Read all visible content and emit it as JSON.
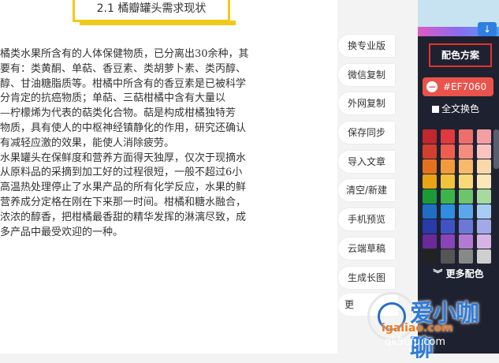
{
  "editor": {
    "heading": "2.1 橘瓣罐头需求现状",
    "lines": [
      "橘类水果所含有的人体保健物质，已分离出30余种，其",
      "要有：类黄酮、单萜、香豆素、类胡萝卜素、类丙醇、",
      "醇、甘油糖脂质等。柑橘中所含有的香豆素是已被科学",
      "分肯定的抗癌物质；单萜、三萜柑橘中含有大量以",
      "—柠檬烯为代表的萜类化合物。萜是构成柑橘独特芳",
      "物质，具有使人的中枢神经镇静化的作用，研究还确认",
      "有减轻应激的效果，能使人消除疲劳。",
      "水果罐头在保鲜度和营养方面得天独厚，仅次于现摘水",
      "从原料品的采摘到加工好的过程很短，一般不超过6小",
      "高温热处理停止了水果产品的所有化学反应，水果的鲜",
      "营养成分定格在刚在下来那一时间。柑橘和糖水融合，",
      "浓浓的醇香，把柑橘最香甜的精华发挥的淋漓尽致，成",
      "多产品中最受欢迎的一种。"
    ]
  },
  "toolbar": {
    "buttons": [
      "换专业版",
      "微信复制",
      "外网复制",
      "保存同步",
      "导入文章",
      "清空/新建",
      "手机预览",
      "云端草稿",
      "生成长图"
    ],
    "partial": "更"
  },
  "panel": {
    "banner_arrow": "↓",
    "title": "配色方案",
    "color_value": "#EF7060",
    "minus_icon": "−",
    "full_swap_label": "全文换色",
    "more_colors": "更多配色",
    "more_colors_icon": "︾",
    "swatches": [
      [
        "#c0282d",
        "#e0393e",
        "#ee6e6b",
        "#f39fa4"
      ],
      [
        "#d33f2f",
        "#ef5d4f",
        "#f58c7d",
        "#f7c4c2"
      ],
      [
        "#e5711f",
        "#f39a3a",
        "#f7b96a",
        "#f9d9a9"
      ],
      [
        "#e8a316",
        "#f3c23b",
        "#f7da77",
        "#fae8b8"
      ],
      [
        "#1c9a37",
        "#3cb44b",
        "#6ec46b",
        "#a8d9a0"
      ],
      [
        "#1e6fc4",
        "#2f8ee0",
        "#5aa8ec",
        "#a7cdf3"
      ],
      [
        "#2a3aa8",
        "#4053c4",
        "#6c78d6",
        "#a2a9e6"
      ],
      [
        "#6a2a9a",
        "#8a43b8",
        "#b47ad2",
        "#d6b4e6"
      ],
      [
        "#222222",
        "#555555",
        "#888888",
        "#cfcfcf"
      ]
    ]
  },
  "watermark": {
    "title": "爱小咖聊",
    "url": "igaliao.com",
    "url2": "qk5ufu.com"
  }
}
